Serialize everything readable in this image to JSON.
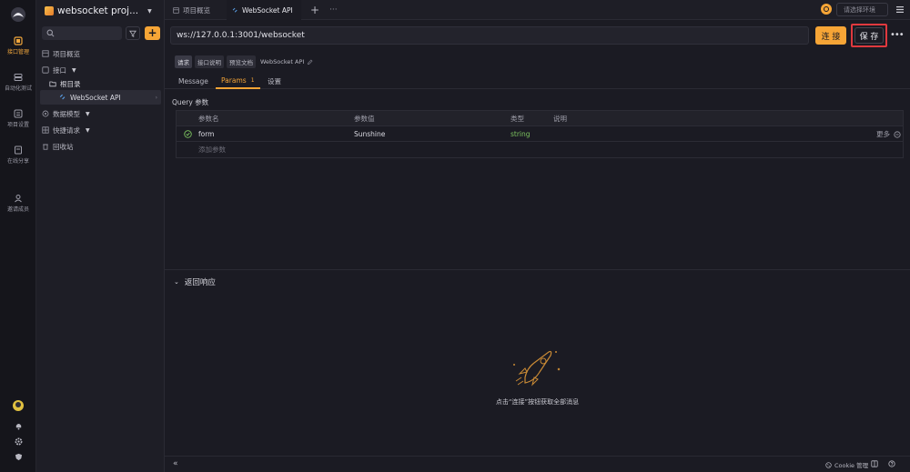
{
  "rail": {
    "items": [
      {
        "label": "接口管理",
        "icon": "api-icon"
      },
      {
        "label": "自动化测试",
        "icon": "automation-icon"
      },
      {
        "label": "项目设置",
        "icon": "settings-icon"
      },
      {
        "label": "在线分享",
        "icon": "share-icon"
      },
      {
        "label": "邀请成员",
        "icon": "invite-icon"
      }
    ]
  },
  "sidebar": {
    "project_name": "websocket proj...",
    "tree": {
      "overview": "项目概览",
      "apis": "接口",
      "root": "根目录",
      "ws_api": "WebSocket API",
      "models": "数据模型",
      "quick": "快捷请求",
      "trash": "回收站"
    }
  },
  "tabs": {
    "overview": "项目概览",
    "ws": "WebSocket API",
    "env_placeholder": "请选择环境"
  },
  "request": {
    "url": "ws://127.0.0.1:3001/websocket",
    "connect_label": "连 接",
    "save_label": "保 存",
    "chips": [
      "请求",
      "接口说明",
      "预览文档"
    ],
    "name": "WebSocket API"
  },
  "subtabs": {
    "message": "Message",
    "params": "Params",
    "params_count": "1",
    "settings": "设置"
  },
  "params": {
    "title": "Query 参数",
    "headers": {
      "name": "参数名",
      "value": "参数值",
      "type": "类型",
      "desc": "说明"
    },
    "rows": [
      {
        "name": "form",
        "value": "Sunshine",
        "type": "string",
        "more": "更多"
      }
    ],
    "add_placeholder": "添加参数"
  },
  "response": {
    "title": "返回响应",
    "empty_message": "点击“连接”按钮获取全部消息"
  },
  "footer": {
    "cookie": "Cookie 管理"
  },
  "colors": {
    "accent": "#f6a536",
    "highlight": "#e0393e",
    "type_string": "#7cc35f"
  }
}
